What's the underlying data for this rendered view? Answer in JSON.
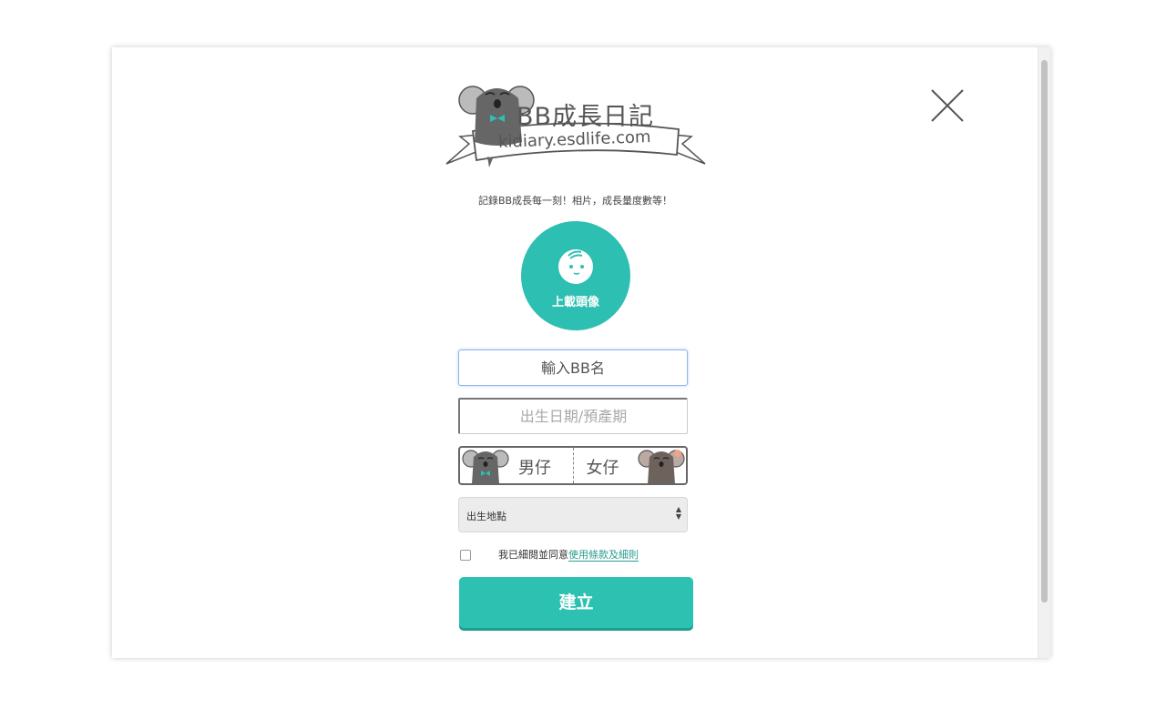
{
  "logo": {
    "title": "BB成長日記",
    "url": "kidiary.esdlife.com"
  },
  "tagline": "記錄BB成長每一刻！相片，成長量度數等！",
  "avatar": {
    "label": "上載頭像",
    "icon": "baby-face-icon"
  },
  "form": {
    "name_placeholder": "輸入BB名",
    "date_placeholder": "出生日期/預產期",
    "gender_boy": "男仔",
    "gender_girl": "女仔",
    "place_select": "出生地點",
    "agree_text": "我已細閱並同意",
    "terms_link": "使用條款及細則",
    "submit": "建立"
  },
  "icons": {
    "close": "close-icon",
    "koala_boy": "koala-boy-icon",
    "koala_girl": "koala-girl-icon"
  },
  "colors": {
    "accent": "#2dbfb1",
    "accent_dark": "#1f9e92",
    "link": "#2a9d8f"
  }
}
